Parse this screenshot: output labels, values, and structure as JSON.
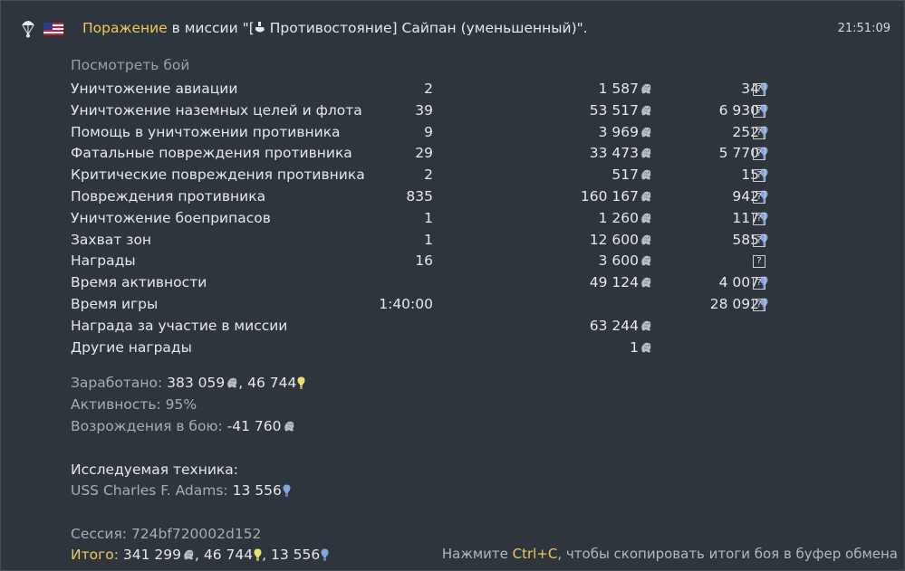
{
  "header": {
    "result": "Поражение",
    "text_in": " в миссии \"[",
    "text_mission": " Противостояние] Сайпан (уменьшенный)\".",
    "time": "21:51:09"
  },
  "view_battle": "Посмотреть бой",
  "rows": [
    {
      "label": "Уничтожение авиации",
      "count": "2",
      "silver": "1 587",
      "rp": "34",
      "help": "?"
    },
    {
      "label": "Уничтожение наземных целей и флота",
      "count": "39",
      "silver": "53 517",
      "rp": "6 930",
      "help": "?"
    },
    {
      "label": "Помощь в уничтожении противника",
      "count": "9",
      "silver": "3 969",
      "rp": "252",
      "help": "?"
    },
    {
      "label": "Фатальные повреждения противника",
      "count": "29",
      "silver": "33 473",
      "rp": "5 770",
      "help": "?"
    },
    {
      "label": "Критические повреждения противника",
      "count": "2",
      "silver": "517",
      "rp": "15",
      "help": "?"
    },
    {
      "label": "Повреждения противника",
      "count": "835",
      "silver": "160 167",
      "rp": "942",
      "help": "?"
    },
    {
      "label": "Уничтожение боеприпасов",
      "count": "1",
      "silver": "1 260",
      "rp": "117",
      "help": "?"
    },
    {
      "label": "Захват зон",
      "count": "1",
      "silver": "12 600",
      "rp": "585",
      "help": "?"
    },
    {
      "label": "Награды",
      "count": "16",
      "silver": "3 600",
      "rp": "",
      "help": "?"
    },
    {
      "label": "Время активности",
      "count": "",
      "silver": "49 124",
      "rp": "4 007",
      "help": "?"
    },
    {
      "label": "Время игры",
      "count": "1:40:00",
      "silver": "",
      "rp": "28 092",
      "help": "?"
    },
    {
      "label": "Награда за участие в миссии",
      "count": "",
      "silver": "63 244",
      "rp": "",
      "help": ""
    },
    {
      "label": "Другие награды",
      "count": "",
      "silver": "1",
      "rp": "",
      "help": ""
    }
  ],
  "earned": {
    "label": "Заработано:",
    "silver": "383 059",
    "sep": ",",
    "rp": "46 744"
  },
  "activity": {
    "label": "Активность: 95%"
  },
  "respawn": {
    "label": "Возрождения в бою:",
    "value": "-41 760"
  },
  "research": {
    "title": "Исследуемая техника:",
    "vehicle": "USS Charles F. Adams:",
    "rp": "13 556"
  },
  "session": {
    "label": "Сессия: 724bf720002d152"
  },
  "total": {
    "label": "Итого:",
    "silver": "341 299",
    "sep1": ",",
    "rp": "46 744",
    "sep2": ",",
    "crp": "13 556"
  },
  "hint": {
    "pre": "Нажмите ",
    "key": "Ctrl+C",
    "post": ", чтобы скопировать итоги боя в буфер обмена"
  },
  "colors": {
    "accent": "#f0c85c",
    "rp_yellow": "#e8e070",
    "rp_blue": "#7fa6de",
    "background": "#2f353c"
  }
}
